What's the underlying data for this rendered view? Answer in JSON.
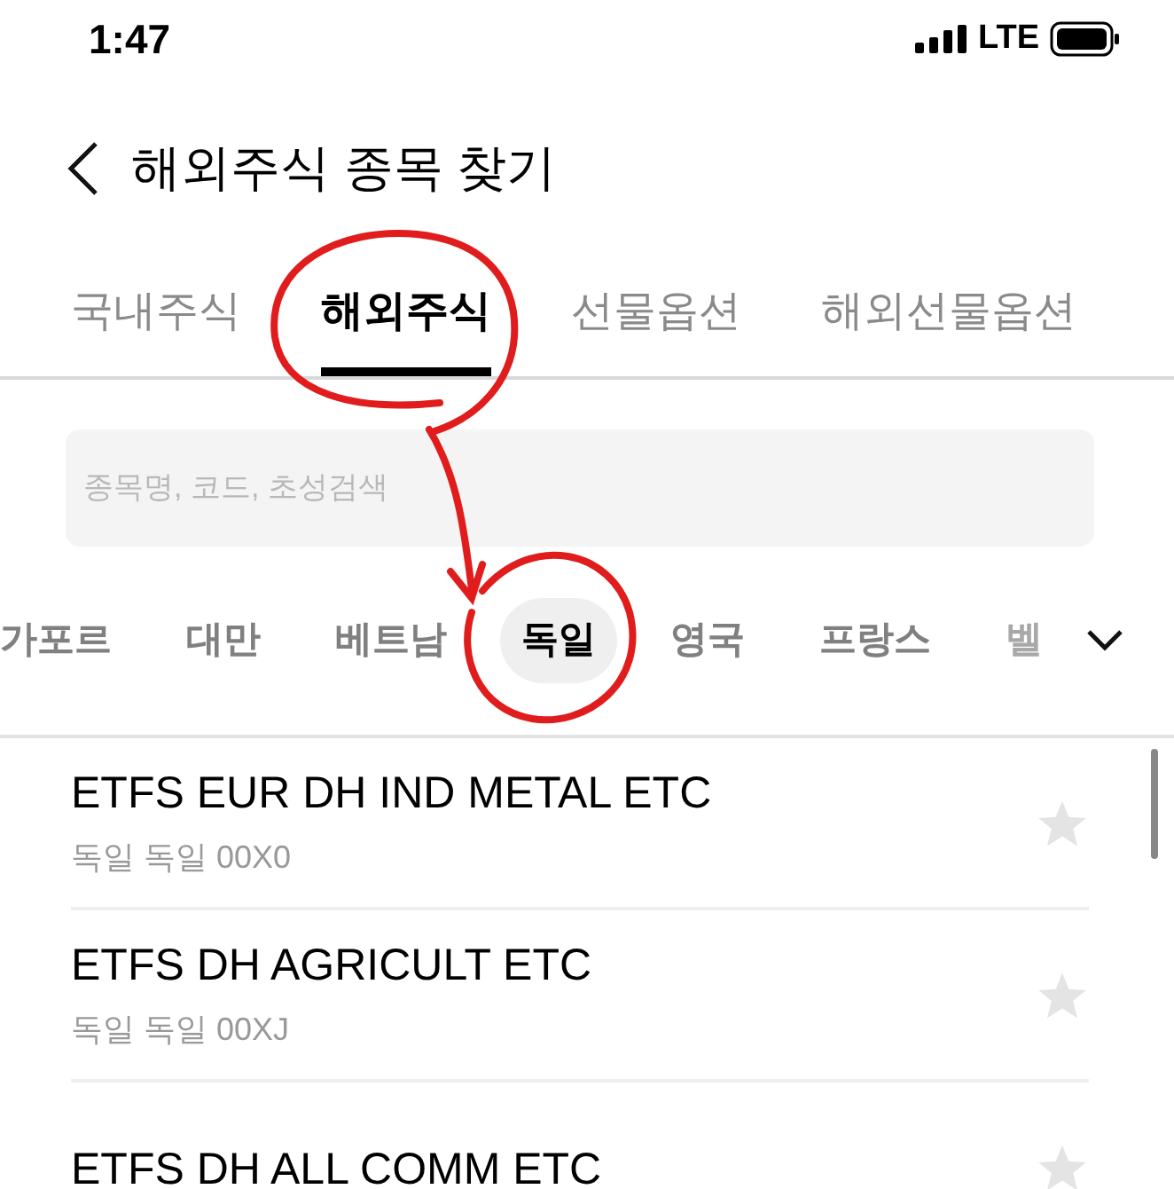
{
  "status_bar": {
    "time": "1:47",
    "network": "LTE"
  },
  "header": {
    "title": "해외주식 종목 찾기"
  },
  "tabs": [
    {
      "label": "국내주식",
      "selected": false
    },
    {
      "label": "해외주식",
      "selected": true
    },
    {
      "label": "선물옵션",
      "selected": false
    },
    {
      "label": "해외선물옵션",
      "selected": false
    }
  ],
  "search": {
    "placeholder": "종목명, 코드, 초성검색"
  },
  "countries": [
    {
      "label": "가포르",
      "selected": false
    },
    {
      "label": "대만",
      "selected": false
    },
    {
      "label": "베트남",
      "selected": false
    },
    {
      "label": "독일",
      "selected": true
    },
    {
      "label": "영국",
      "selected": false
    },
    {
      "label": "프랑스",
      "selected": false
    },
    {
      "label": "벨",
      "selected": false
    }
  ],
  "stocks": [
    {
      "name": "ETFS EUR DH IND METAL ETC",
      "detail": "독일 독일 00X0",
      "favorite": false
    },
    {
      "name": "ETFS DH AGRICULT ETC",
      "detail": "독일 독일 00XJ",
      "favorite": false
    },
    {
      "name": "ETFS DH ALL COMM ETC",
      "favorite": false
    }
  ]
}
